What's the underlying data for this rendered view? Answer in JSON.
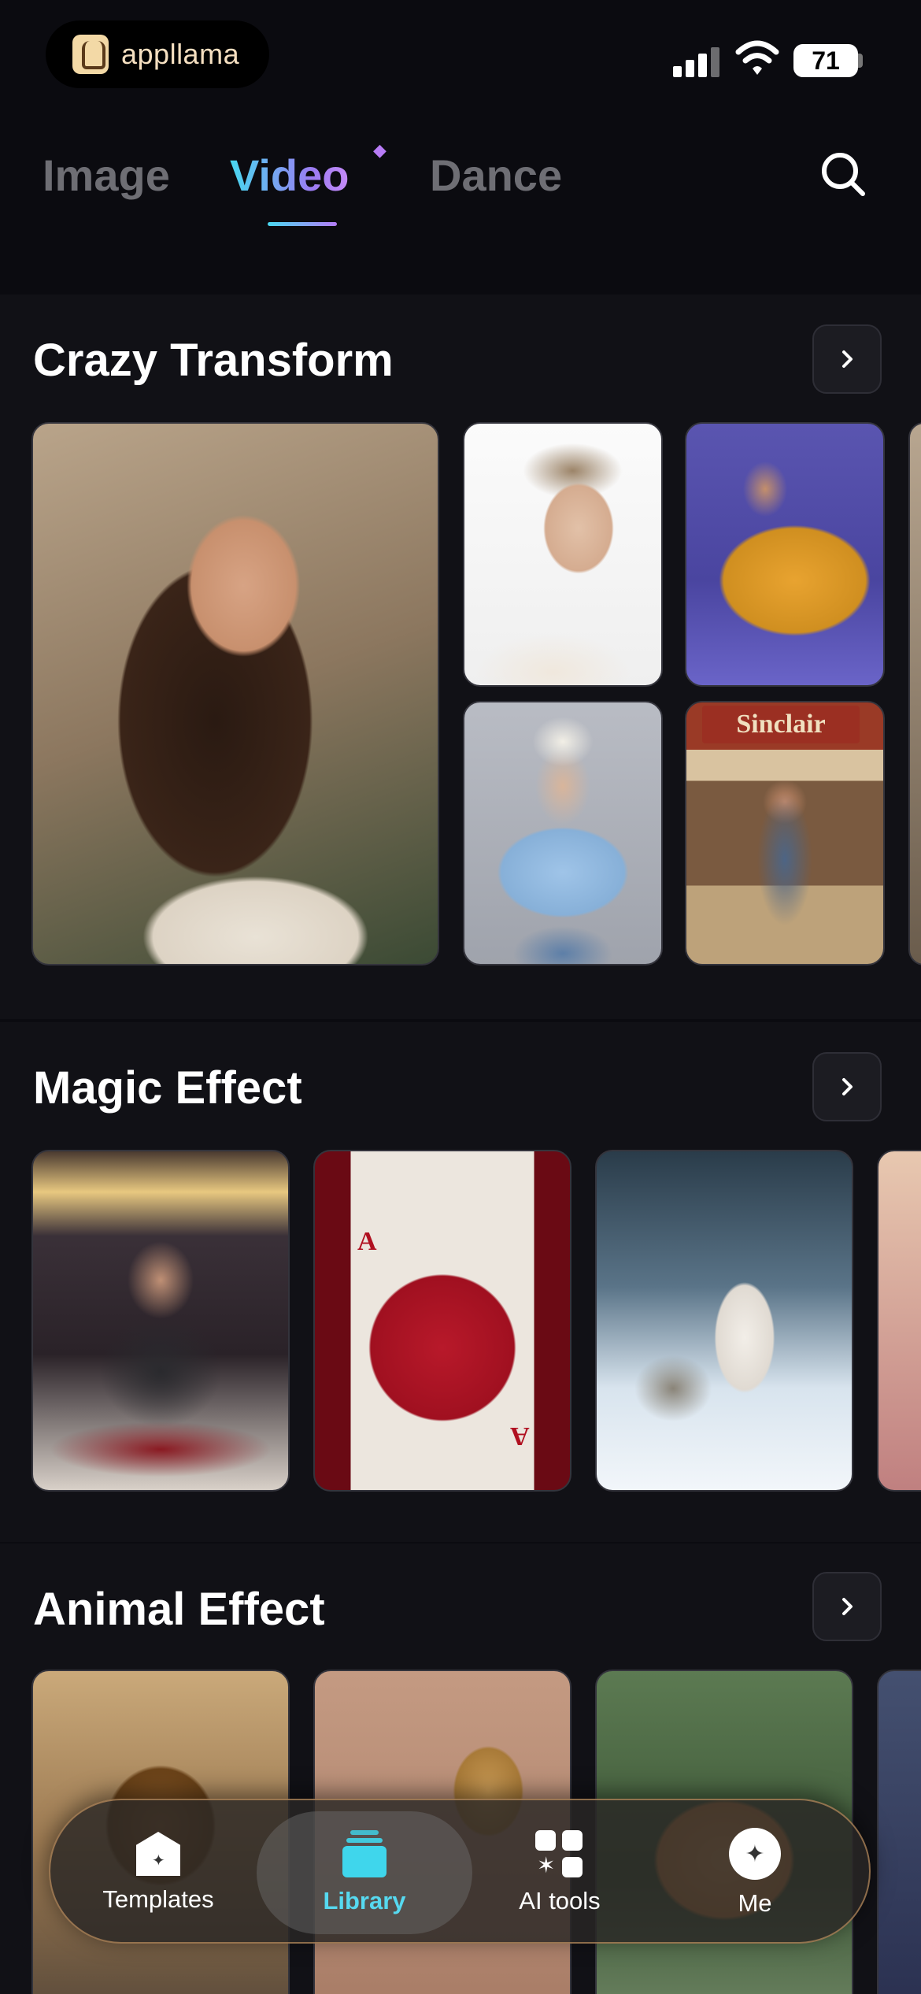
{
  "status_bar": {
    "brand_name": "appllama",
    "battery": "71"
  },
  "top_tabs": {
    "items": [
      "Image",
      "Video",
      "Dance"
    ],
    "active": "Video"
  },
  "sections": [
    {
      "title": "Crazy Transform"
    },
    {
      "title": "Magic Effect"
    },
    {
      "title": "Animal Effect"
    }
  ],
  "photo_text": {
    "sinclair_sign": "Sinclair",
    "card_rank": "A"
  },
  "bottom_nav": {
    "items": [
      {
        "label": "Templates",
        "icon": "templates-icon"
      },
      {
        "label": "Library",
        "icon": "library-icon"
      },
      {
        "label": "AI tools",
        "icon": "ai-tools-icon"
      },
      {
        "label": "Me",
        "icon": "me-icon"
      }
    ],
    "active": "Library"
  },
  "colors": {
    "background": "#0b0b10",
    "section_background": "#111116",
    "accent_cyan": "#48d8f0",
    "accent_purple": "#b47cf6",
    "nav_active": "#56d9f0"
  }
}
